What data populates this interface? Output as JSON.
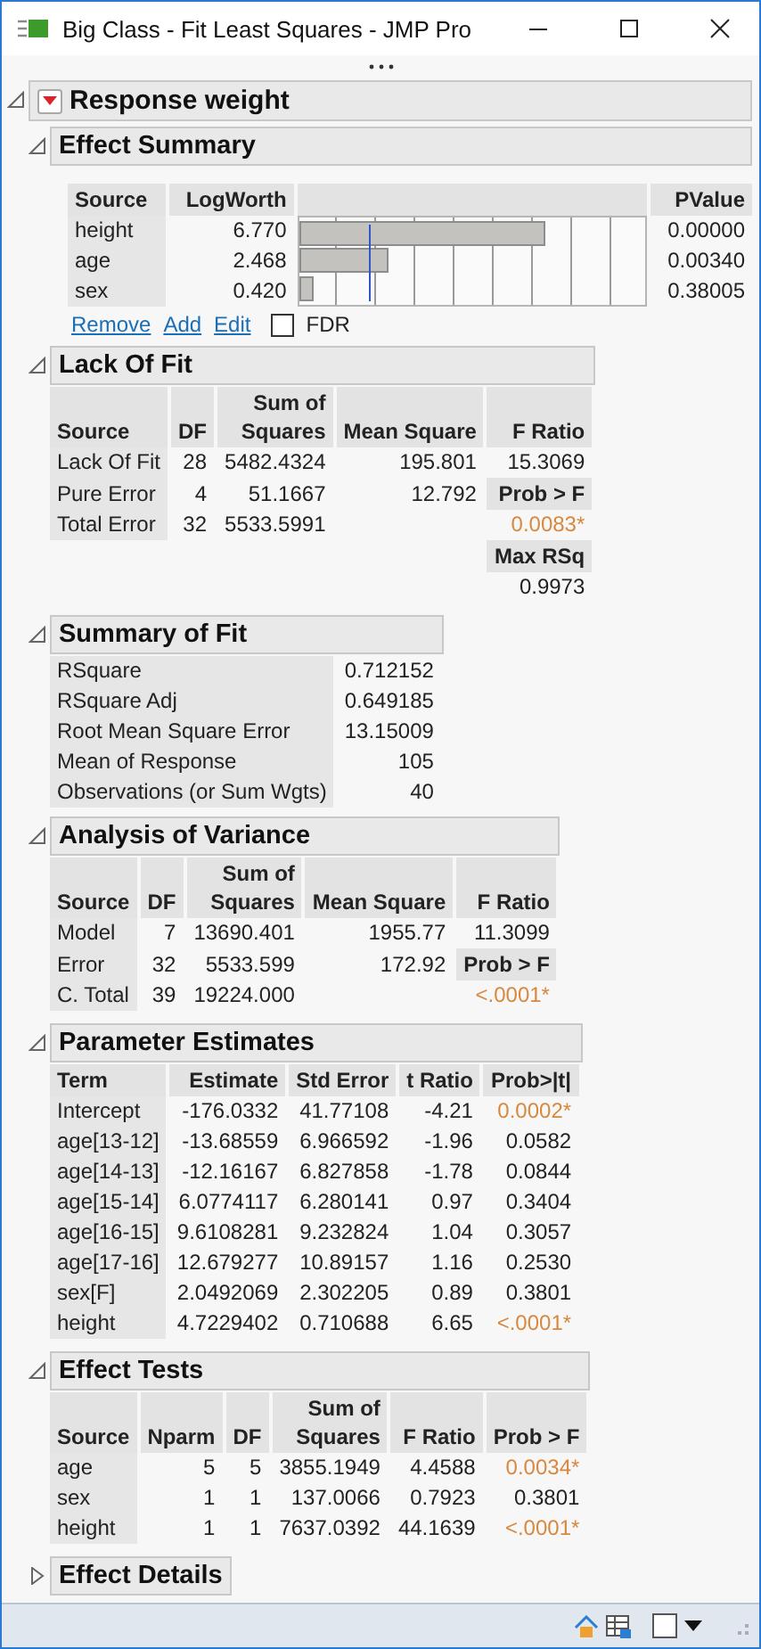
{
  "window": {
    "title": "Big Class - Fit Least Squares - JMP Pro"
  },
  "report": {
    "title": "Response weight",
    "expanded": true
  },
  "sections": [
    {
      "kind": "effect_summary",
      "title": "Effect Summary",
      "expanded": true,
      "columns": [
        "Source",
        "LogWorth",
        "PValue"
      ],
      "rows": [
        {
          "source": "height",
          "logworth": "6.770",
          "pvalue": "0.00000",
          "level": 0.71
        },
        {
          "source": "age",
          "logworth": "2.468",
          "pvalue": "0.00340",
          "level": 0.26
        },
        {
          "source": "sex",
          "logworth": "0.420",
          "pvalue": "0.38005",
          "level": 0.04
        }
      ],
      "links": [
        "Remove",
        "Add",
        "Edit"
      ],
      "fdr": {
        "label": "FDR",
        "checked": false
      }
    },
    {
      "kind": "table",
      "title": "Lack Of Fit",
      "expanded": true,
      "columns": [
        "Source",
        "DF",
        "Sum of\nSquares",
        "Mean Square"
      ],
      "rows": [
        {
          "cells": [
            "Lack Of Fit",
            "28",
            "5482.4324",
            "195.801"
          ]
        },
        {
          "cells": [
            "Pure Error",
            "4",
            "51.1667",
            "12.792"
          ]
        },
        {
          "cells": [
            "Total Error",
            "32",
            "5533.5991",
            ""
          ]
        }
      ],
      "side": {
        "header": "F Ratio",
        "items": [
          {
            "kind": "value",
            "text": "15.3069"
          },
          {
            "kind": "header",
            "text": "Prob > F"
          },
          {
            "kind": "significant",
            "text": "0.0083*"
          },
          {
            "kind": "header",
            "text": "Max RSq"
          },
          {
            "kind": "value",
            "text": "0.9973"
          }
        ]
      }
    },
    {
      "kind": "pairs",
      "title": "Summary of Fit",
      "expanded": true,
      "rows": [
        {
          "cells": [
            "RSquare",
            "0.712152"
          ]
        },
        {
          "cells": [
            "RSquare Adj",
            "0.649185"
          ]
        },
        {
          "cells": [
            "Root Mean Square Error",
            "13.15009"
          ]
        },
        {
          "cells": [
            "Mean of Response",
            "105"
          ]
        },
        {
          "cells": [
            "Observations (or Sum Wgts)",
            "40"
          ]
        }
      ]
    },
    {
      "kind": "table",
      "title": "Analysis of Variance",
      "expanded": true,
      "columns": [
        "Source",
        "DF",
        "Sum of\nSquares",
        "Mean Square"
      ],
      "rows": [
        {
          "cells": [
            "Model",
            "7",
            "13690.401",
            "1955.77"
          ]
        },
        {
          "cells": [
            "Error",
            "32",
            "5533.599",
            "172.92"
          ]
        },
        {
          "cells": [
            "C. Total",
            "39",
            "19224.000",
            ""
          ]
        }
      ],
      "side": {
        "header": "F Ratio",
        "items": [
          {
            "kind": "value",
            "text": "11.3099"
          },
          {
            "kind": "header",
            "text": "Prob > F"
          },
          {
            "kind": "significant",
            "text": "<.0001*"
          }
        ]
      }
    },
    {
      "kind": "table",
      "title": "Parameter Estimates",
      "expanded": true,
      "columns": [
        "Term",
        "Estimate",
        "Std Error",
        "t Ratio",
        "Prob>|t|"
      ],
      "rows": [
        {
          "cells": [
            "Intercept",
            "-176.0332",
            "41.77108",
            "-4.21",
            "0.0002*"
          ],
          "significant": true
        },
        {
          "cells": [
            "age[13-12]",
            "-13.68559",
            "6.966592",
            "-1.96",
            "0.0582"
          ],
          "significant": false
        },
        {
          "cells": [
            "age[14-13]",
            "-12.16167",
            "6.827858",
            "-1.78",
            "0.0844"
          ],
          "significant": false
        },
        {
          "cells": [
            "age[15-14]",
            "6.0774117",
            "6.280141",
            "0.97",
            "0.3404"
          ],
          "significant": false
        },
        {
          "cells": [
            "age[16-15]",
            "9.6108281",
            "9.232824",
            "1.04",
            "0.3057"
          ],
          "significant": false
        },
        {
          "cells": [
            "age[17-16]",
            "12.679277",
            "10.89157",
            "1.16",
            "0.2530"
          ],
          "significant": false
        },
        {
          "cells": [
            "sex[F]",
            "2.0492069",
            "2.302205",
            "0.89",
            "0.3801"
          ],
          "significant": false
        },
        {
          "cells": [
            "height",
            "4.7229402",
            "0.710688",
            "6.65",
            "<.0001*"
          ],
          "significant": true
        }
      ]
    },
    {
      "kind": "table",
      "title": "Effect Tests",
      "expanded": true,
      "columns": [
        "Source",
        "Nparm",
        "DF",
        "Sum of\nSquares",
        "F Ratio",
        "Prob > F"
      ],
      "rows": [
        {
          "cells": [
            "age",
            "5",
            "5",
            "3855.1949",
            "4.4588",
            "0.0034*"
          ],
          "significant": true
        },
        {
          "cells": [
            "sex",
            "1",
            "1",
            "137.0066",
            "0.7923",
            "0.3801"
          ],
          "significant": false
        },
        {
          "cells": [
            "height",
            "1",
            "1",
            "7637.0392",
            "44.1639",
            "<.0001*"
          ],
          "significant": true
        }
      ]
    },
    {
      "kind": "table",
      "title": "Effect Details",
      "expanded": false
    }
  ],
  "status_bar": {
    "checkbox_checked": false
  }
}
